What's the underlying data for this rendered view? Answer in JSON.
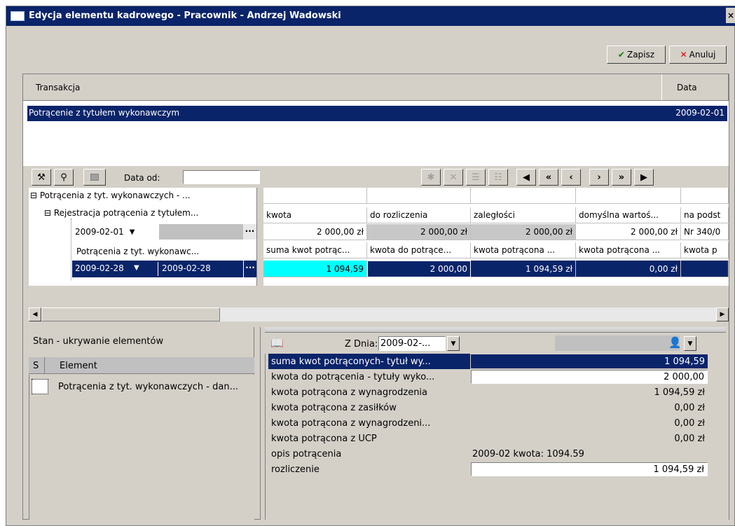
{
  "window": {
    "title": "Edycja elementu kadrowego - Pracownik - Andrzej Wadowski",
    "close_glyph": "×"
  },
  "toolbar": {
    "save_label": "Zapisz",
    "cancel_label": "Anuluj"
  },
  "transactions": {
    "columns": [
      "Transakcja",
      "Data"
    ],
    "rows": [
      {
        "name": "Potrącenie z tytułem wykonawczym",
        "date": "2009-02-01"
      }
    ]
  },
  "grid_toolbar": {
    "date_from_label": "Data od:",
    "date_from_value": "",
    "dots": "..."
  },
  "tree": {
    "node1": "Potrącenia z tyt. wykonawczych - ...",
    "node2": "Rejestracja potrącenia z tytułem...",
    "row1_date": "2009-02-01",
    "node3": "Potrącenia z tyt. wykonawc...",
    "row2_date_from": "2009-02-28",
    "row2_date_to": "2009-02-28"
  },
  "grid": {
    "headers1": [
      "kwota",
      "do rozliczenia",
      "zaległości",
      "domyślna wartoś...",
      "na podst"
    ],
    "row1": [
      "2 000,00 zł",
      "2 000,00 zł",
      "2 000,00 zł",
      "2 000,00 zł",
      "Nr 340/0"
    ],
    "headers2": [
      "suma kwot potrąc...",
      "kwota do potrące...",
      "kwota potrącona ...",
      "kwota potrącona ...",
      "kwota p"
    ],
    "row2": [
      "1 094,59",
      "2 000,00",
      "1 094,59 zł",
      "0,00 zł",
      ""
    ]
  },
  "left_panel": {
    "title": "Stan - ukrywanie elementów",
    "col_s": "S",
    "col_element": "Element",
    "items": [
      "Potrącenia z tyt. wykonawczych - dan..."
    ]
  },
  "props": {
    "z_dnia_label": "Z Dnia:",
    "z_dnia_value": "2009-02-...",
    "rows": [
      {
        "label": "suma kwot potrąconych- tytuł wy...",
        "value": "1 094,59"
      },
      {
        "label": "kwota do potrącenia - tytuły wyko...",
        "value": "2 000,00"
      },
      {
        "label": "kwota potrącona z wynagrodzenia",
        "value": "1 094,59 zł"
      },
      {
        "label": "kwota potrącona z zasiłków",
        "value": "0,00 zł"
      },
      {
        "label": "kwota potrącona z wynagrodzeni...",
        "value": "0,00 zł"
      },
      {
        "label": "kwota potrącona z UCP",
        "value": "0,00 zł"
      },
      {
        "label": "opis potrącenia",
        "value": "2009-02 kwota: 1094.59"
      },
      {
        "label": "rozliczenie",
        "value": "1 094,59 zł"
      }
    ]
  },
  "colors": {
    "selection": "#0a246a",
    "cyan_cell": "#00ffff",
    "face": "#d4d0c8"
  }
}
